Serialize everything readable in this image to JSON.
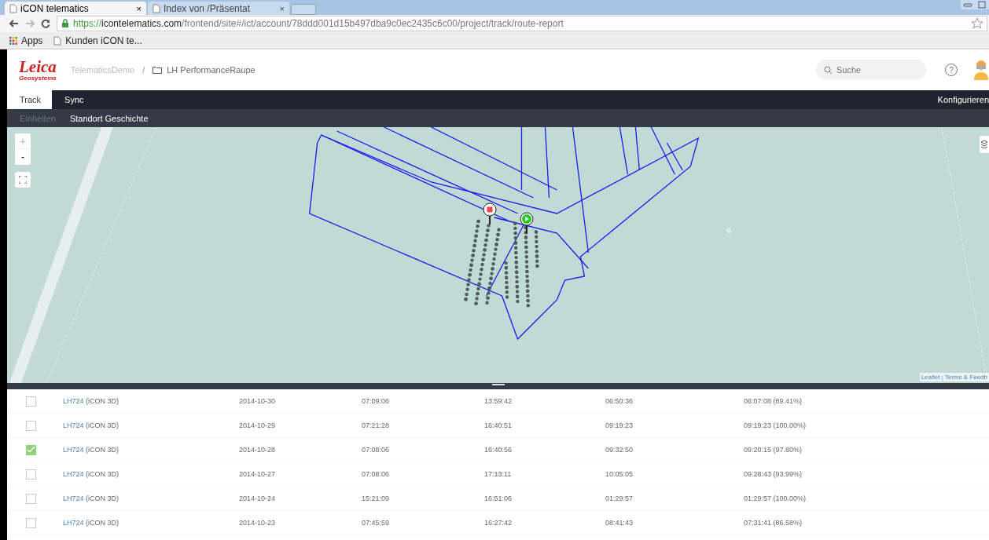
{
  "browser": {
    "tabs": [
      {
        "title": "iCON telematics",
        "close": "×",
        "selected": true
      },
      {
        "title": "Index von /Präsentat",
        "close": "×",
        "selected": false
      }
    ],
    "url": {
      "scheme": "https://",
      "host": "icontelematics.com",
      "path": "/frontend/site#/ict/account/78ddd001d15b497dba9c0ec2435c6c00/project/track/route-report"
    },
    "bookmarks": [
      "Apps",
      "Kunden iCON te..."
    ]
  },
  "header": {
    "logo": "Leica",
    "logo_sub": "Geosystems",
    "breadcrumb": [
      "TelematicsDemo",
      "LH PerformanceRaupe"
    ],
    "breadcrumb_separator": "/",
    "search": {
      "placeholder": "Suche"
    },
    "help": "?"
  },
  "nav": {
    "tabs": [
      {
        "label": "Track",
        "selected": true
      },
      {
        "label": "Sync",
        "selected": false
      }
    ],
    "right": "Konfigurieren"
  },
  "subnav": [
    {
      "label": "Einheiten",
      "selected": false
    },
    {
      "label": "Standort Geschichte",
      "selected": true
    }
  ],
  "map": {
    "zoom_in": "+",
    "zoom_out": "-",
    "attribution": [
      "Leaflet",
      "Terms & Feedb"
    ],
    "attribution_separator": "|"
  },
  "rows": [
    {
      "checked": false,
      "unit": "LH724",
      "model": "(iCON 3D)",
      "date": "2014-10-30",
      "start": "07:09:06",
      "end": "13:59:42",
      "duration": "06:50:36",
      "work": "06:07:08 (89.41%)"
    },
    {
      "checked": false,
      "unit": "LH724",
      "model": "(iCON 3D)",
      "date": "2014-10-29",
      "start": "07:21:28",
      "end": "16:40:51",
      "duration": "09:19:23",
      "work": "09:19:23 (100.00%)"
    },
    {
      "checked": true,
      "unit": "LH724",
      "model": "(iCON 3D)",
      "date": "2014-10-28",
      "start": "07:08:06",
      "end": "16:40:56",
      "duration": "09:32:50",
      "work": "09:20:15 (97.80%)"
    },
    {
      "checked": false,
      "unit": "LH724",
      "model": "(iCON 3D)",
      "date": "2014-10-27",
      "start": "07:08:06",
      "end": "17:13:11",
      "duration": "10:05:05",
      "work": "09:28:43 (93.99%)"
    },
    {
      "checked": false,
      "unit": "LH724",
      "model": "(iCON 3D)",
      "date": "2014-10-24",
      "start": "15:21:09",
      "end": "16:51:06",
      "duration": "01:29:57",
      "work": "01:29:57 (100.00%)"
    },
    {
      "checked": false,
      "unit": "LH724",
      "model": "(iCON 3D)",
      "date": "2014-10-23",
      "start": "07:45:59",
      "end": "16:27:42",
      "duration": "08:41:43",
      "work": "07:31:41 (86.58%)"
    }
  ]
}
